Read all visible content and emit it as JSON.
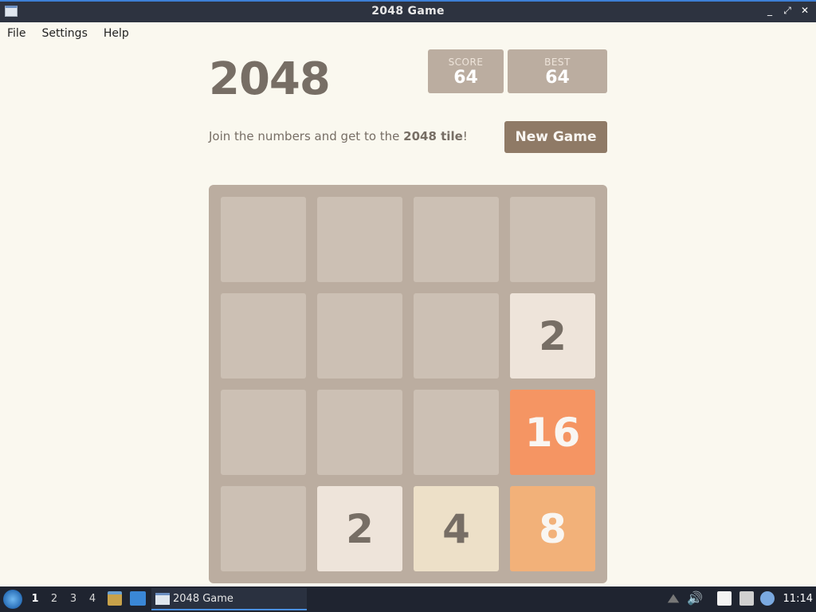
{
  "window": {
    "title": "2048 Game",
    "controls": [
      "_",
      "⤢",
      "✕"
    ]
  },
  "menu": [
    "File",
    "Settings",
    "Help"
  ],
  "game": {
    "title": "2048",
    "score_label": "SCORE",
    "score_value": "64",
    "best_label": "BEST",
    "best_value": "64",
    "intro_prefix": "Join the numbers and get to the ",
    "intro_bold": "2048 tile",
    "intro_suffix": "!",
    "new_game_label": "New Game"
  },
  "board": {
    "grid": [
      [
        "",
        "",
        "",
        ""
      ],
      [
        "",
        "",
        "",
        "2"
      ],
      [
        "",
        "",
        "",
        "16"
      ],
      [
        "",
        "2",
        "4",
        "8"
      ]
    ]
  },
  "taskbar": {
    "workspaces": [
      "1",
      "2",
      "3",
      "4"
    ],
    "active_workspace": "1",
    "task_label": "2048 Game",
    "clock": "11:14"
  }
}
